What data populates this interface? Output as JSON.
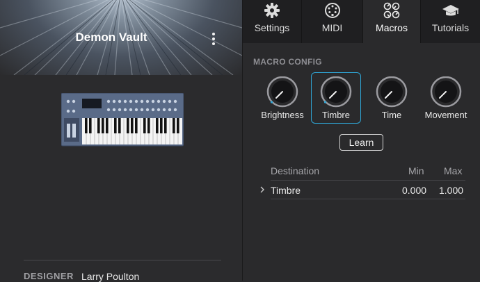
{
  "preset": {
    "name": "Demon Vault",
    "designer_label": "DESIGNER",
    "designer_name": "Larry Poulton"
  },
  "tabs": [
    {
      "label": "Settings",
      "icon": "gear-icon",
      "active": false
    },
    {
      "label": "MIDI",
      "icon": "midi-connector-icon",
      "active": false
    },
    {
      "label": "Macros",
      "icon": "macros-knobs-icon",
      "active": true
    },
    {
      "label": "Tutorials",
      "icon": "graduation-cap-icon",
      "active": false
    }
  ],
  "macro_config": {
    "title": "MACRO CONFIG",
    "knobs": [
      {
        "label": "Brightness",
        "value": 0.0,
        "selected": false
      },
      {
        "label": "Timbre",
        "value": 0.0,
        "selected": true
      },
      {
        "label": "Time",
        "value": 0.0,
        "selected": false
      },
      {
        "label": "Movement",
        "value": 0.0,
        "selected": false
      }
    ],
    "learn_label": "Learn"
  },
  "table": {
    "headers": {
      "destination": "Destination",
      "min": "Min",
      "max": "Max"
    },
    "rows": [
      {
        "destination": "Timbre",
        "min": "0.000",
        "max": "1.000"
      }
    ]
  },
  "colors": {
    "accent": "#2fa6d6",
    "panel": "#2a2a2c",
    "tabbar": "#1f1f21"
  }
}
